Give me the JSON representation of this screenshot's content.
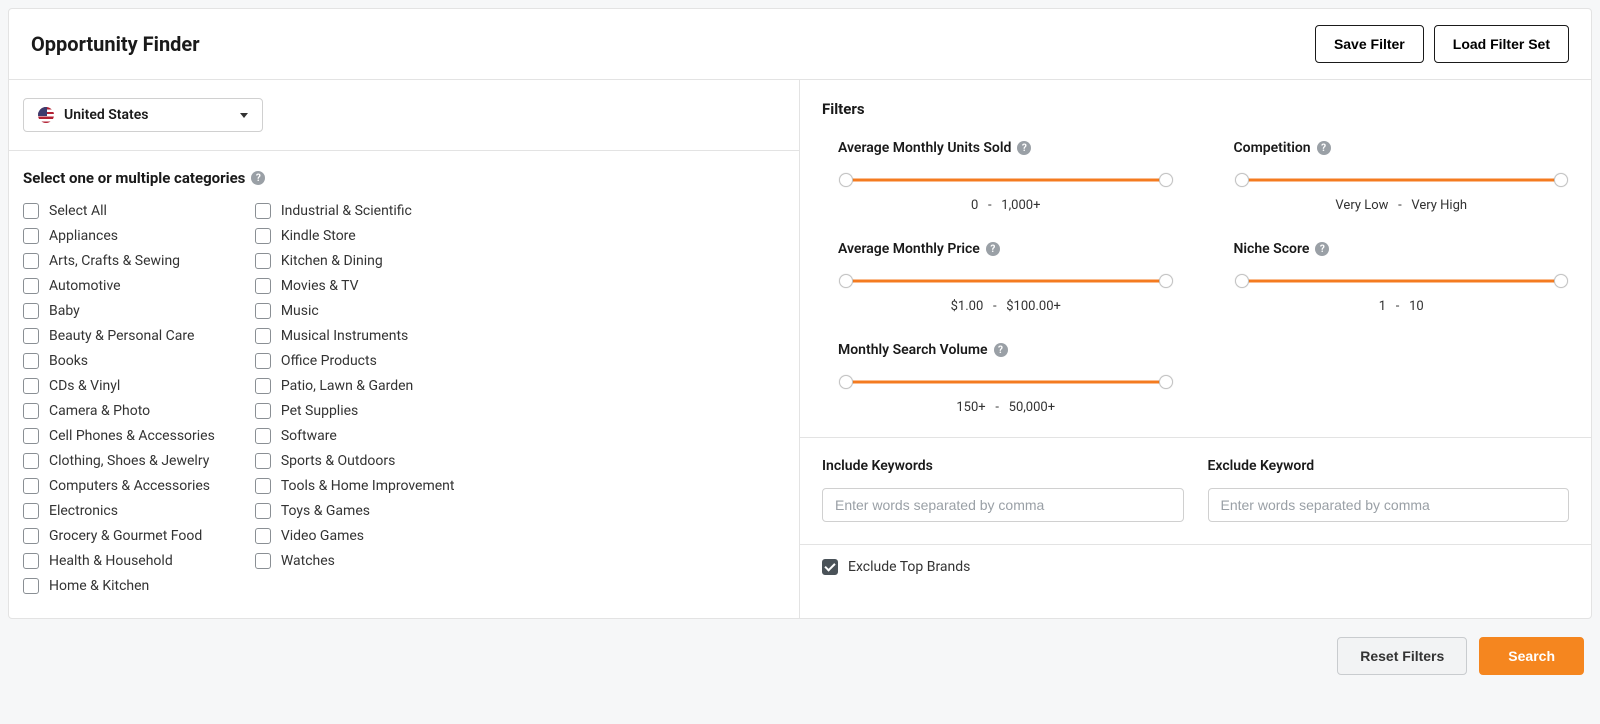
{
  "header": {
    "title": "Opportunity Finder",
    "save_filter": "Save Filter",
    "load_filter_set": "Load Filter Set"
  },
  "country": {
    "selected": "United States"
  },
  "categories": {
    "heading": "Select one or multiple categories",
    "select_all": "Select All",
    "col1": [
      "Appliances",
      "Arts, Crafts & Sewing",
      "Automotive",
      "Baby",
      "Beauty & Personal Care",
      "Books",
      "CDs & Vinyl",
      "Camera & Photo",
      "Cell Phones & Accessories",
      "Clothing, Shoes & Jewelry",
      "Computers & Accessories",
      "Electronics",
      "Grocery & Gourmet Food",
      "Health & Household",
      "Home & Kitchen"
    ],
    "col2": [
      "Industrial & Scientific",
      "Kindle Store",
      "Kitchen & Dining",
      "Movies & TV",
      "Music",
      "Musical Instruments",
      "Office Products",
      "Patio, Lawn & Garden",
      "Pet Supplies",
      "Software",
      "Sports & Outdoors",
      "Tools & Home Improvement",
      "Toys & Games",
      "Video Games",
      "Watches"
    ]
  },
  "filters": {
    "title": "Filters",
    "units": {
      "label": "Average Monthly Units Sold",
      "min": "0",
      "max": "1,000+"
    },
    "competition": {
      "label": "Competition",
      "min": "Very Low",
      "max": "Very High"
    },
    "price": {
      "label": "Average Monthly Price",
      "min": "$1.00",
      "max": "$100.00+"
    },
    "niche": {
      "label": "Niche Score",
      "min": "1",
      "max": "10"
    },
    "search_volume": {
      "label": "Monthly Search Volume",
      "min": "150+",
      "max": "50,000+"
    },
    "separator": "-"
  },
  "keywords": {
    "include_label": "Include Keywords",
    "exclude_label": "Exclude Keyword",
    "placeholder": "Enter words separated by comma"
  },
  "exclude_top_brands": {
    "label": "Exclude Top Brands",
    "checked": true
  },
  "footer": {
    "reset": "Reset Filters",
    "search": "Search"
  },
  "help_glyph": "?"
}
